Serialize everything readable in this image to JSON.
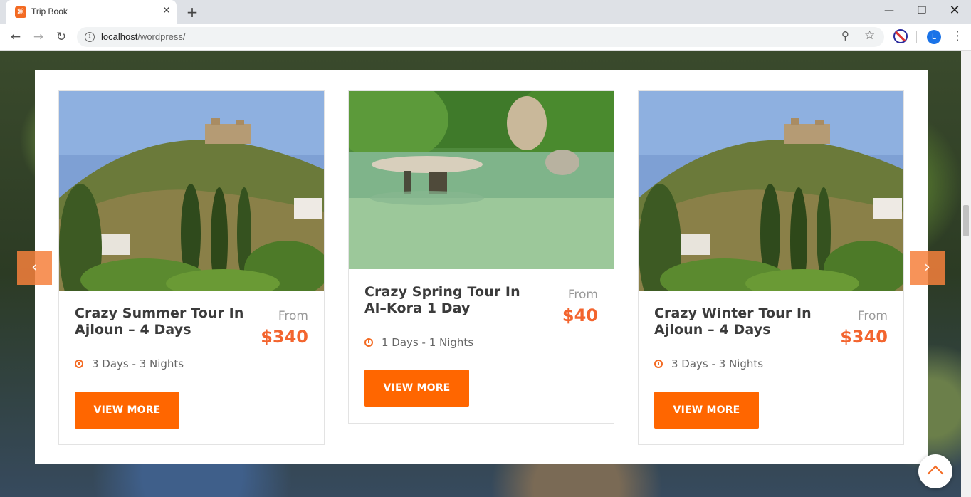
{
  "browser": {
    "tab_title": "Trip Book",
    "tab_favicon": "⌘",
    "url_host": "localhost",
    "url_path": "/wordpress/",
    "profile_initial": "L",
    "icons": [
      "back-arrow-icon",
      "forward-arrow-icon",
      "reload-icon",
      "info-icon",
      "zoom-icon",
      "star-icon",
      "extension-blocked-icon",
      "menu-icon"
    ]
  },
  "carousel": {
    "prev_label": "‹",
    "next_label": "›",
    "tours": [
      {
        "title": "Crazy Summer Tour In Ajloun – 4 Days",
        "from_label": "From",
        "price": "$340",
        "duration": "3 Days - 3 Nights",
        "button_label": "VIEW MORE",
        "image": "castle-hill"
      },
      {
        "title": "Crazy Spring Tour In Al–Kora 1 Day",
        "from_label": "From",
        "price": "$40",
        "duration": "1 Days - 1 Nights",
        "button_label": "VIEW MORE",
        "image": "river-stone-table"
      },
      {
        "title": "Crazy Winter Tour In Ajloun – 4 Days",
        "from_label": "From",
        "price": "$340",
        "duration": "3 Days - 3 Nights",
        "button_label": "VIEW MORE",
        "image": "castle-hill"
      }
    ]
  },
  "colors": {
    "accent": "#ff6600",
    "price": "#f3652f"
  }
}
